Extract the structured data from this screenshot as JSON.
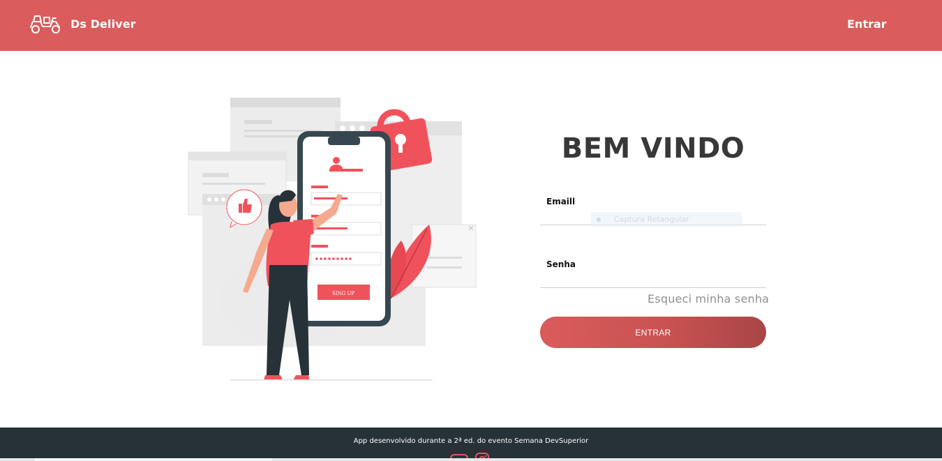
{
  "navbar": {
    "brand_name": "Ds Deliver",
    "login_label": "Entrar",
    "background": "#da5c5c"
  },
  "illustration": {
    "signup_button_label": "SING UP"
  },
  "login_form": {
    "heading": "BEM VINDO",
    "email_label": "Emaill",
    "email_value": "",
    "password_label": "Senha",
    "password_value": "",
    "forgot_password_label": "Esqueci minha senha",
    "submit_label": "ENTRAR",
    "accent": "#d95c5c"
  },
  "capture_overlay": {
    "label": "Captura Retangular"
  },
  "footer": {
    "text": "App desenvolvido durante a 2ª ed. do evento Semana DevSuperior",
    "icons": [
      "youtube-icon",
      "instagram-icon"
    ],
    "background": "#263238"
  }
}
